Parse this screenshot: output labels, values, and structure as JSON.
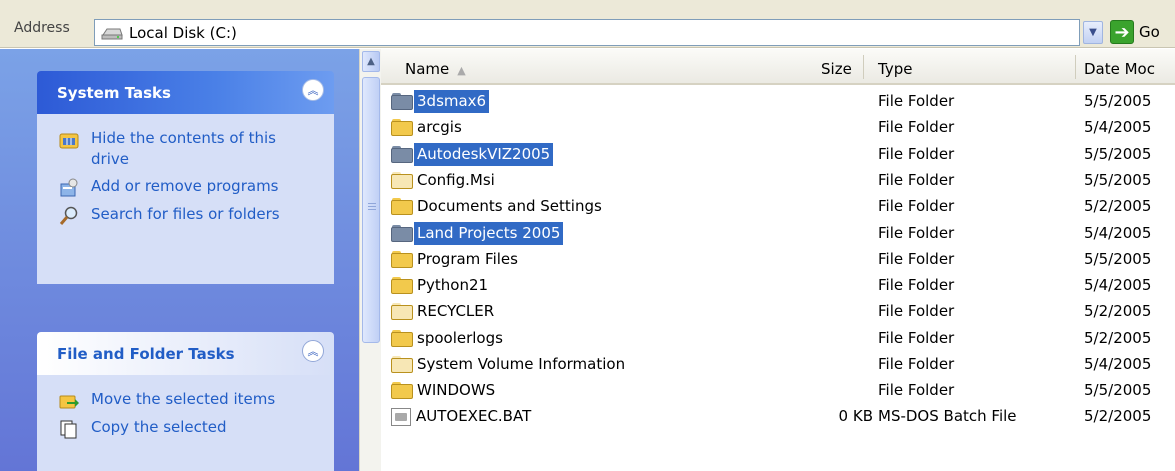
{
  "address": {
    "label": "Address",
    "value": "Local Disk (C:)",
    "go_label": "Go"
  },
  "left_pane": {
    "system_tasks": {
      "title": "System Tasks",
      "items": [
        {
          "label": "Hide the contents of this drive",
          "icon": "view-icon"
        },
        {
          "label": "Add or remove programs",
          "icon": "add-remove-programs-icon"
        },
        {
          "label": "Search for files or folders",
          "icon": "search-icon"
        }
      ]
    },
    "file_folder_tasks": {
      "title": "File and Folder Tasks",
      "items": [
        {
          "label": "Move the selected items",
          "icon": "move-icon"
        },
        {
          "label": "Copy the selected",
          "icon": "copy-icon"
        }
      ]
    }
  },
  "columns": {
    "name": "Name",
    "size": "Size",
    "type": "Type",
    "date": "Date Moc"
  },
  "files": [
    {
      "name": "3dsmax6",
      "size": "",
      "type": "File Folder",
      "date": "5/5/2005",
      "selected": true,
      "kind": "folder"
    },
    {
      "name": "arcgis",
      "size": "",
      "type": "File Folder",
      "date": "5/4/2005",
      "selected": false,
      "kind": "folder"
    },
    {
      "name": "AutodeskVIZ2005",
      "size": "",
      "type": "File Folder",
      "date": "5/5/2005",
      "selected": true,
      "kind": "folder"
    },
    {
      "name": "Config.Msi",
      "size": "",
      "type": "File Folder",
      "date": "5/5/2005",
      "selected": false,
      "kind": "folder-hidden"
    },
    {
      "name": "Documents and Settings",
      "size": "",
      "type": "File Folder",
      "date": "5/2/2005",
      "selected": false,
      "kind": "folder"
    },
    {
      "name": "Land Projects 2005",
      "size": "",
      "type": "File Folder",
      "date": "5/4/2005",
      "selected": true,
      "kind": "folder"
    },
    {
      "name": "Program Files",
      "size": "",
      "type": "File Folder",
      "date": "5/5/2005",
      "selected": false,
      "kind": "folder"
    },
    {
      "name": "Python21",
      "size": "",
      "type": "File Folder",
      "date": "5/4/2005",
      "selected": false,
      "kind": "folder"
    },
    {
      "name": "RECYCLER",
      "size": "",
      "type": "File Folder",
      "date": "5/2/2005",
      "selected": false,
      "kind": "folder-hidden"
    },
    {
      "name": "spoolerlogs",
      "size": "",
      "type": "File Folder",
      "date": "5/2/2005",
      "selected": false,
      "kind": "folder"
    },
    {
      "name": "System Volume Information",
      "size": "",
      "type": "File Folder",
      "date": "5/4/2005",
      "selected": false,
      "kind": "folder-hidden"
    },
    {
      "name": "WINDOWS",
      "size": "",
      "type": "File Folder",
      "date": "5/5/2005",
      "selected": false,
      "kind": "folder"
    },
    {
      "name": "AUTOEXEC.BAT",
      "size": "0 KB",
      "type": "MS-DOS Batch File",
      "date": "5/2/2005",
      "selected": false,
      "kind": "bat"
    }
  ],
  "colors": {
    "selection": "#316ac5",
    "folder": "#f2c94c",
    "folder_hidden": "#f7e7b5",
    "folder_selected": "#7a8ca6",
    "task_link": "#215dc6"
  }
}
